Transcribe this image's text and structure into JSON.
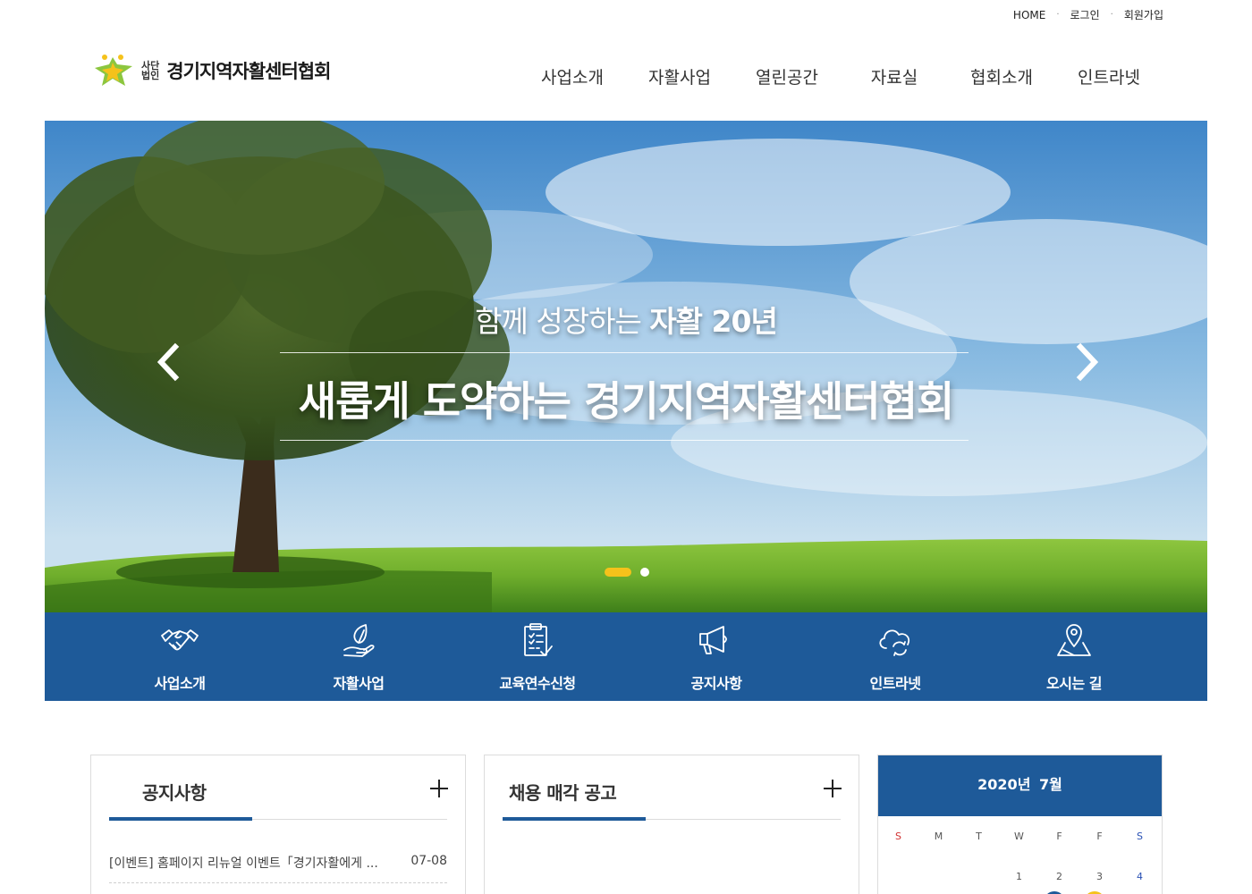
{
  "util_nav": {
    "home": "HOME",
    "login": "로그인",
    "signup": "회원가입",
    "separator": "·"
  },
  "logo": {
    "small_top": "사단",
    "small_bottom": "법인",
    "name": "경기지역자활센터협회"
  },
  "nav": [
    "사업소개",
    "자활사업",
    "열린공간",
    "자료실",
    "협회소개",
    "인트라넷"
  ],
  "hero": {
    "subtitle_plain": "함께 성장하는 ",
    "subtitle_bold": "자활 20년",
    "title": "새롭게 도약하는 경기지역자활센터협회",
    "slides": 2,
    "active_slide": 1
  },
  "quick_menu": [
    {
      "label": "사업소개",
      "icon": "handshake-icon"
    },
    {
      "label": "자활사업",
      "icon": "hand-leaf-icon"
    },
    {
      "label": "교육연수신청",
      "icon": "checklist-icon"
    },
    {
      "label": "공지사항",
      "icon": "megaphone-icon"
    },
    {
      "label": "인트라넷",
      "icon": "cloud-sync-icon"
    },
    {
      "label": "오시는 길",
      "icon": "map-pin-icon"
    }
  ],
  "notice": {
    "title": "공지사항",
    "items": [
      {
        "title": "[이벤트] 홈페이지 리뉴얼 이벤트「경기자활에게 ...",
        "date": "07-08"
      }
    ]
  },
  "recruit": {
    "title": "채용 매각 공고"
  },
  "calendar": {
    "year_month": "2020년 7월",
    "weekdays": [
      "S",
      "M",
      "T",
      "W",
      "F",
      "F",
      "S"
    ],
    "first_row": [
      "",
      "",
      "",
      "1",
      "2",
      "3",
      "4"
    ]
  },
  "colors": {
    "brand_blue": "#1e5a99",
    "accent_yellow": "#f5c21b"
  }
}
